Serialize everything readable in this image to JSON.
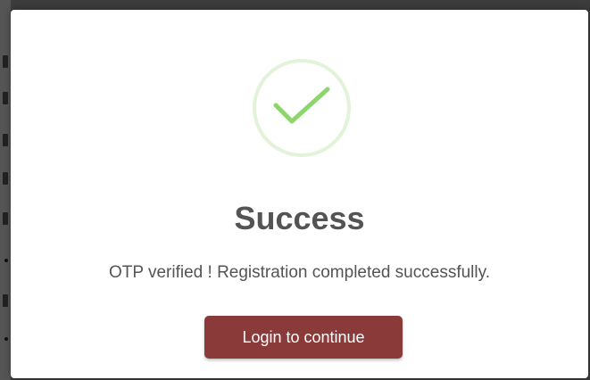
{
  "dialog": {
    "icon": "checkmark-icon",
    "title": "Success",
    "message": "OTP verified ! Registration completed successfully.",
    "button_label": "Login to continue"
  },
  "colors": {
    "check": "#8fd56e",
    "check_ring": "#e2f3d9",
    "button": "#8b3a3a",
    "text": "#545454"
  }
}
